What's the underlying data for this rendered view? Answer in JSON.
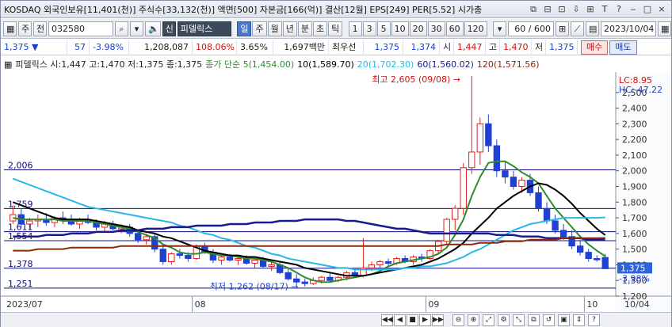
{
  "titlebar": {
    "title": "KOSDAQ 외국인보유[11,401(천)] 주식수[33,132(천)] 액면[500] 자본금[166(억)] 결산[12월] EPS[249] PER[5.52] 시가총",
    "icons": [
      "link-icon",
      "pin-icon",
      "restore-icon",
      "transfer-icon",
      "chart-type-icon",
      "text-icon",
      "help-icon",
      "minimize-icon",
      "maximize-icon",
      "close-icon"
    ],
    "icon_glyphs": [
      "⧉",
      "⊟",
      "⊡",
      "⇩",
      "⊞",
      "T",
      "?",
      "‒",
      "□",
      "×"
    ]
  },
  "toolbar": {
    "market_selector": "주",
    "prev_label": "전",
    "code": "032580",
    "company_badge": "신",
    "company_name": "피델릭스",
    "periods": [
      "일",
      "주",
      "월",
      "년",
      "분",
      "초",
      "틱"
    ],
    "active_period": "일",
    "intervals": [
      "1",
      "3",
      "5",
      "10",
      "20",
      "30",
      "60",
      "120"
    ],
    "count": "60",
    "count_total": "600",
    "date": "2023/10/04"
  },
  "info": {
    "price": "1,375",
    "arrow": "▼",
    "change": "57",
    "change_pct": "-3.98%",
    "volume": "1,208,087",
    "volume_ratio": "108.06%",
    "turnover": "3.65%",
    "amount": "1,697백만",
    "pref_label": "최우선",
    "pref_value": "1,375",
    "pref_value2": "1,374",
    "open_label": "시",
    "open": "1,447",
    "high_label": "고",
    "high": "1,470",
    "low_label": "저",
    "low": "1,375",
    "buy_label": "매수",
    "sell_label": "매도"
  },
  "legend": {
    "ohlc": "피델릭스 시:1,447 고:1,470 저:1,375 종:1,375",
    "ma_title": "종가 단순 5(1,454.00)",
    "ma10": "10(1,589.70)",
    "ma20": "20(1,702.30)",
    "ma60": "60(1,560.02)",
    "ma120": "120(1,571.56)",
    "lc": "LC:8.95",
    "hc": "HC:-47.22"
  },
  "colors": {
    "ma5": "#2e8b2e",
    "ma10": "#000000",
    "ma20": "#29b6e6",
    "ma60": "#1a1a8c",
    "ma120": "#8b2a0a",
    "up": "#e02020",
    "down": "#2040d0",
    "hline": "#0c0c80"
  },
  "chart_data": {
    "type": "line",
    "title": "피델릭스 일봉",
    "ylim": [
      1200,
      2600
    ],
    "y_ticks": [
      1200,
      1300,
      1400,
      1500,
      1600,
      1700,
      1800,
      1900,
      2000,
      2100,
      2200,
      2300,
      2400,
      2500
    ],
    "y_tick_labels": [
      "1,200",
      "1,300",
      "1,400",
      "1,500",
      "1,600",
      "1,700",
      "1,800",
      "1,900",
      "2,000",
      "2,100",
      "2,200",
      "2,300",
      "2,400",
      "2,500"
    ],
    "x_labels": [
      "2023/07",
      "08",
      "09",
      "10",
      "10/04"
    ],
    "x_label_index": [
      0,
      22,
      50,
      69,
      72
    ],
    "n_candles": 72,
    "hlines": [
      {
        "value": 2006,
        "label": "2,006"
      },
      {
        "value": 1759,
        "label": "1,759"
      },
      {
        "value": 1611,
        "label": "1,611"
      },
      {
        "value": 1554,
        "label": "1,554"
      },
      {
        "value": 1378,
        "label": "1,378"
      },
      {
        "value": 1251,
        "label": "1,251"
      }
    ],
    "annotations": [
      {
        "label": "최고 2,605 (09/08)",
        "index": 55,
        "value": 2605
      },
      {
        "label": "최저 1,262 (08/17)",
        "index": 35,
        "value": 1262
      }
    ],
    "last_price_label": "1,375",
    "last_pct_label": "-3.98%",
    "candles": [
      [
        1680,
        1780,
        1660,
        1720
      ],
      [
        1720,
        1760,
        1640,
        1660
      ],
      [
        1660,
        1700,
        1620,
        1680
      ],
      [
        1680,
        1720,
        1640,
        1690
      ],
      [
        1690,
        1730,
        1650,
        1670
      ],
      [
        1670,
        1710,
        1640,
        1700
      ],
      [
        1700,
        1740,
        1660,
        1680
      ],
      [
        1680,
        1720,
        1650,
        1660
      ],
      [
        1660,
        1700,
        1630,
        1690
      ],
      [
        1690,
        1720,
        1660,
        1670
      ],
      [
        1670,
        1690,
        1620,
        1640
      ],
      [
        1640,
        1680,
        1610,
        1660
      ],
      [
        1660,
        1680,
        1620,
        1630
      ],
      [
        1630,
        1660,
        1600,
        1640
      ],
      [
        1640,
        1660,
        1580,
        1600
      ],
      [
        1600,
        1620,
        1540,
        1560
      ],
      [
        1560,
        1600,
        1530,
        1580
      ],
      [
        1580,
        1600,
        1480,
        1500
      ],
      [
        1500,
        1520,
        1400,
        1420
      ],
      [
        1420,
        1480,
        1400,
        1470
      ],
      [
        1470,
        1500,
        1440,
        1460
      ],
      [
        1460,
        1480,
        1420,
        1440
      ],
      [
        1440,
        1530,
        1430,
        1520
      ],
      [
        1520,
        1540,
        1470,
        1480
      ],
      [
        1480,
        1500,
        1410,
        1430
      ],
      [
        1430,
        1460,
        1400,
        1450
      ],
      [
        1450,
        1470,
        1420,
        1430
      ],
      [
        1430,
        1450,
        1400,
        1440
      ],
      [
        1440,
        1460,
        1400,
        1410
      ],
      [
        1410,
        1440,
        1380,
        1430
      ],
      [
        1430,
        1450,
        1380,
        1390
      ],
      [
        1390,
        1420,
        1360,
        1400
      ],
      [
        1400,
        1420,
        1340,
        1350
      ],
      [
        1350,
        1380,
        1300,
        1310
      ],
      [
        1310,
        1340,
        1270,
        1290
      ],
      [
        1290,
        1310,
        1262,
        1280
      ],
      [
        1280,
        1320,
        1270,
        1300
      ],
      [
        1300,
        1330,
        1280,
        1320
      ],
      [
        1320,
        1350,
        1290,
        1300
      ],
      [
        1300,
        1330,
        1290,
        1320
      ],
      [
        1320,
        1360,
        1300,
        1350
      ],
      [
        1350,
        1370,
        1320,
        1330
      ],
      [
        1330,
        1570,
        1320,
        1380
      ],
      [
        1380,
        1420,
        1360,
        1400
      ],
      [
        1400,
        1430,
        1370,
        1420
      ],
      [
        1420,
        1440,
        1390,
        1410
      ],
      [
        1410,
        1450,
        1400,
        1440
      ],
      [
        1440,
        1460,
        1410,
        1420
      ],
      [
        1420,
        1460,
        1400,
        1450
      ],
      [
        1450,
        1470,
        1420,
        1440
      ],
      [
        1440,
        1500,
        1430,
        1490
      ],
      [
        1490,
        1560,
        1470,
        1550
      ],
      [
        1550,
        1700,
        1530,
        1690
      ],
      [
        1690,
        1780,
        1620,
        1760
      ],
      [
        1760,
        2050,
        1720,
        2020
      ],
      [
        2020,
        2605,
        1980,
        2120
      ],
      [
        2120,
        2340,
        2040,
        2300
      ],
      [
        2300,
        2360,
        2120,
        2160
      ],
      [
        2160,
        2200,
        1960,
        2000
      ],
      [
        2000,
        2060,
        1920,
        1960
      ],
      [
        1960,
        2000,
        1880,
        1900
      ],
      [
        1900,
        1960,
        1860,
        1940
      ],
      [
        1940,
        1980,
        1840,
        1860
      ],
      [
        1860,
        1900,
        1740,
        1760
      ],
      [
        1760,
        1800,
        1660,
        1680
      ],
      [
        1680,
        1720,
        1600,
        1620
      ],
      [
        1620,
        1660,
        1560,
        1580
      ],
      [
        1580,
        1620,
        1500,
        1520
      ],
      [
        1520,
        1560,
        1460,
        1480
      ],
      [
        1480,
        1500,
        1420,
        1440
      ],
      [
        1440,
        1460,
        1420,
        1432
      ],
      [
        1447,
        1470,
        1375,
        1375
      ]
    ],
    "series": [
      {
        "name": "5",
        "values": [
          1700,
          1690,
          1690,
          1690,
          1690,
          1690,
          1680,
          1680,
          1680,
          1680,
          1670,
          1660,
          1650,
          1640,
          1630,
          1610,
          1590,
          1570,
          1530,
          1510,
          1480,
          1470,
          1470,
          1480,
          1470,
          1460,
          1460,
          1450,
          1440,
          1440,
          1430,
          1420,
          1400,
          1380,
          1350,
          1320,
          1300,
          1290,
          1290,
          1300,
          1310,
          1320,
          1330,
          1340,
          1360,
          1390,
          1410,
          1420,
          1430,
          1440,
          1450,
          1470,
          1510,
          1590,
          1690,
          1840,
          1960,
          2050,
          2060,
          2060,
          2030,
          1990,
          1960,
          1920,
          1840,
          1760,
          1700,
          1640,
          1580,
          1530,
          1490,
          1454
        ]
      },
      {
        "name": "10",
        "values": [
          1800,
          1780,
          1760,
          1740,
          1720,
          1700,
          1690,
          1690,
          1690,
          1690,
          1680,
          1670,
          1660,
          1650,
          1640,
          1620,
          1610,
          1600,
          1580,
          1570,
          1550,
          1530,
          1510,
          1490,
          1480,
          1470,
          1460,
          1460,
          1450,
          1450,
          1440,
          1430,
          1420,
          1410,
          1400,
          1380,
          1370,
          1360,
          1350,
          1340,
          1330,
          1330,
          1330,
          1340,
          1350,
          1360,
          1370,
          1380,
          1390,
          1400,
          1420,
          1440,
          1470,
          1500,
          1540,
          1600,
          1650,
          1700,
          1760,
          1800,
          1840,
          1870,
          1900,
          1920,
          1910,
          1880,
          1840,
          1790,
          1730,
          1680,
          1630,
          1589.7
        ]
      },
      {
        "name": "20",
        "values": [
          1950,
          1930,
          1910,
          1890,
          1870,
          1850,
          1830,
          1810,
          1790,
          1770,
          1760,
          1750,
          1740,
          1730,
          1720,
          1710,
          1700,
          1690,
          1680,
          1670,
          1650,
          1640,
          1620,
          1600,
          1590,
          1570,
          1560,
          1540,
          1520,
          1510,
          1490,
          1470,
          1460,
          1440,
          1430,
          1420,
          1410,
          1400,
          1390,
          1380,
          1380,
          1370,
          1370,
          1370,
          1370,
          1370,
          1370,
          1380,
          1380,
          1390,
          1390,
          1400,
          1410,
          1430,
          1450,
          1480,
          1500,
          1530,
          1560,
          1590,
          1620,
          1640,
          1660,
          1670,
          1680,
          1690,
          1700,
          1700,
          1700,
          1700,
          1700,
          1702.3
        ]
      },
      {
        "name": "60",
        "values": [
          1580,
          1580,
          1580,
          1580,
          1590,
          1590,
          1590,
          1600,
          1600,
          1600,
          1610,
          1610,
          1610,
          1620,
          1620,
          1620,
          1630,
          1630,
          1630,
          1640,
          1640,
          1640,
          1650,
          1650,
          1650,
          1650,
          1660,
          1660,
          1660,
          1670,
          1670,
          1670,
          1680,
          1680,
          1680,
          1690,
          1690,
          1690,
          1690,
          1690,
          1680,
          1680,
          1670,
          1660,
          1650,
          1640,
          1630,
          1630,
          1620,
          1610,
          1600,
          1600,
          1600,
          1600,
          1600,
          1600,
          1600,
          1600,
          1590,
          1590,
          1590,
          1580,
          1580,
          1580,
          1570,
          1570,
          1570,
          1570,
          1570,
          1560,
          1560,
          1560.02
        ]
      },
      {
        "name": "120",
        "values": [
          1490,
          1490,
          1490,
          1500,
          1500,
          1500,
          1500,
          1510,
          1510,
          1510,
          1510,
          1510,
          1510,
          1520,
          1520,
          1520,
          1520,
          1520,
          1520,
          1520,
          1520,
          1520,
          1520,
          1520,
          1520,
          1520,
          1520,
          1520,
          1520,
          1520,
          1520,
          1520,
          1520,
          1520,
          1520,
          1520,
          1520,
          1520,
          1520,
          1520,
          1520,
          1520,
          1520,
          1520,
          1520,
          1520,
          1520,
          1520,
          1520,
          1520,
          1520,
          1520,
          1530,
          1530,
          1530,
          1530,
          1540,
          1540,
          1540,
          1550,
          1550,
          1550,
          1560,
          1560,
          1560,
          1560,
          1570,
          1570,
          1570,
          1570,
          1570,
          1571.56
        ]
      }
    ]
  },
  "bottombar": {
    "nav": [
      "◀◀",
      "◀",
      "■",
      "▶",
      "▶▶"
    ],
    "icons": [
      "zoom-out-icon",
      "zoom-in-icon",
      "fit-icon",
      "settings-icon",
      "expand-icon",
      "overlay-icon",
      "reset-icon",
      "save-icon",
      "scroll-icon",
      "help-icon"
    ]
  }
}
